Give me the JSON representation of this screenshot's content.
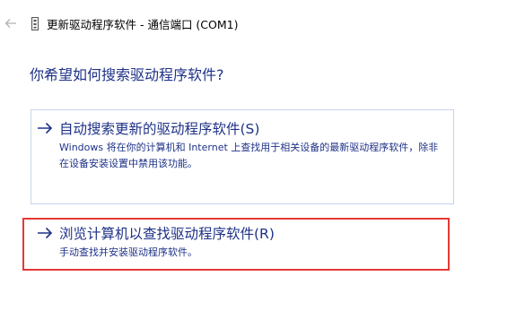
{
  "window": {
    "title": "更新驱动程序软件 - 通信端口 (COM1)"
  },
  "icons": {
    "back": "back-arrow-icon",
    "device": "port-device-icon",
    "option": "arrow-right-icon"
  },
  "colors": {
    "heading": "#1e3287",
    "option_border": "#c5d5ea",
    "highlight_border": "#e53935"
  },
  "main": {
    "question": "你希望如何搜索驱动程序软件?",
    "options": [
      {
        "title": "自动搜索更新的驱动程序软件(S)",
        "description": "Windows 将在你的计算机和 Internet 上查找用于相关设备的最新驱动程序软件，除非在设备安装设置中禁用该功能。"
      },
      {
        "title": "浏览计算机以查找驱动程序软件(R)",
        "description": "手动查找并安装驱动程序软件。"
      }
    ]
  }
}
